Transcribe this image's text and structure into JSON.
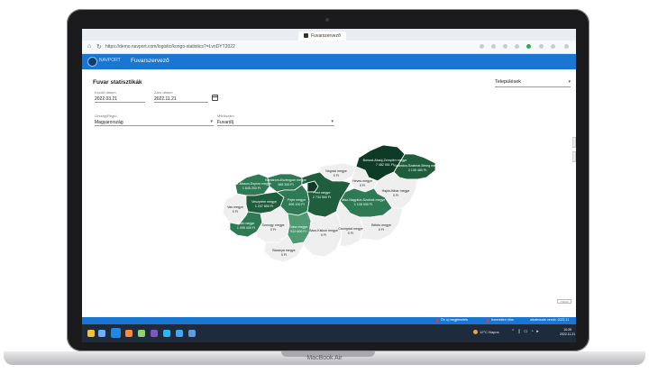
{
  "browser": {
    "tab_title": "Fuvarszervező",
    "url": "https://demo.navport.com/logistic/kongo-statistics?=LvnDYT2022",
    "back_icon": "back-arrow-icon",
    "reload_icon": "reload-icon"
  },
  "app": {
    "logo_text": "NAVPORT",
    "title": "Fuvarszervező"
  },
  "page": {
    "title": "Fuvar statisztikák",
    "settlement_select": "Települések"
  },
  "filters": {
    "from_label": "Kezdő dátum",
    "from_value": "2022.03.21",
    "to_label": "Záró dátum",
    "to_value": "2022.11.21",
    "country_label": "Ország/Régió",
    "country_value": "Magyarország",
    "measure_label": "Mérőszám",
    "measure_value": "Fuvardíj"
  },
  "map": {
    "counties": {
      "borsod": {
        "name": "Borsod-Abaúj-Zemplén megye",
        "value": "7 482 051 Ft"
      },
      "szabolcs": {
        "name": "Szabolcs-Szatmár-Bereg megye",
        "value": "2 135 480 Ft"
      },
      "nograd": {
        "name": "Nógrád megye",
        "value": "0 Ft"
      },
      "heves": {
        "name": "Heves megye",
        "value": "0 Ft"
      },
      "hajdu": {
        "name": "Hajdú-Bihar megye",
        "value": "0 Ft"
      },
      "gyor": {
        "name": "Győr-Moson-Sopron megye",
        "value": "1 645 200 Ft"
      },
      "komarom": {
        "name": "Komárom-Esztergom megye",
        "value": "985 300 Ft"
      },
      "vas": {
        "name": "Vas megye",
        "value": "0 Ft"
      },
      "veszprem": {
        "name": "Veszprém megye",
        "value": "1 247 800 Ft"
      },
      "fejer": {
        "name": "Fejér megye",
        "value": "896 100 Ft"
      },
      "budapest": {
        "name": "Budapest",
        "value": "3 451 200 Ft"
      },
      "pest": {
        "name": "Pest megye",
        "value": "2 734 500 Ft"
      },
      "jasz": {
        "name": "Jász-Nagykun-Szolnok megye",
        "value": "1 128 900 Ft"
      },
      "zala": {
        "name": "Zala megye",
        "value": "1 095 400 Ft"
      },
      "somogy": {
        "name": "Somogy megye",
        "value": "0 Ft"
      },
      "tolna": {
        "name": "Tolna megye",
        "value": "512 600 Ft"
      },
      "bacs": {
        "name": "Bács-Kiskun megye",
        "value": "0 Ft"
      },
      "csongrad": {
        "name": "Csongrád megye",
        "value": "0 Ft"
      },
      "bekes": {
        "name": "Békés megye",
        "value": "0 Ft"
      },
      "baranya": {
        "name": "Baranya megye",
        "value": "0 Ft"
      }
    },
    "palette": {
      "darkest": "#0d3b26",
      "dark": "#1f5e3d",
      "mid": "#2e7a55",
      "light": "#4f9a73",
      "zero": "#efefef",
      "border": "#ffffff"
    },
    "copyright": "©2022"
  },
  "footer": {
    "item1": "Ön új megjelenítés",
    "item2": "Ismeretlen hiba",
    "item3": "alkalmazás verzió: 2022.11"
  },
  "taskbar": {
    "weather": "12°C Napos",
    "time": "10:25",
    "date": "2022.11.21"
  },
  "device": {
    "model": "MacBook Air"
  }
}
